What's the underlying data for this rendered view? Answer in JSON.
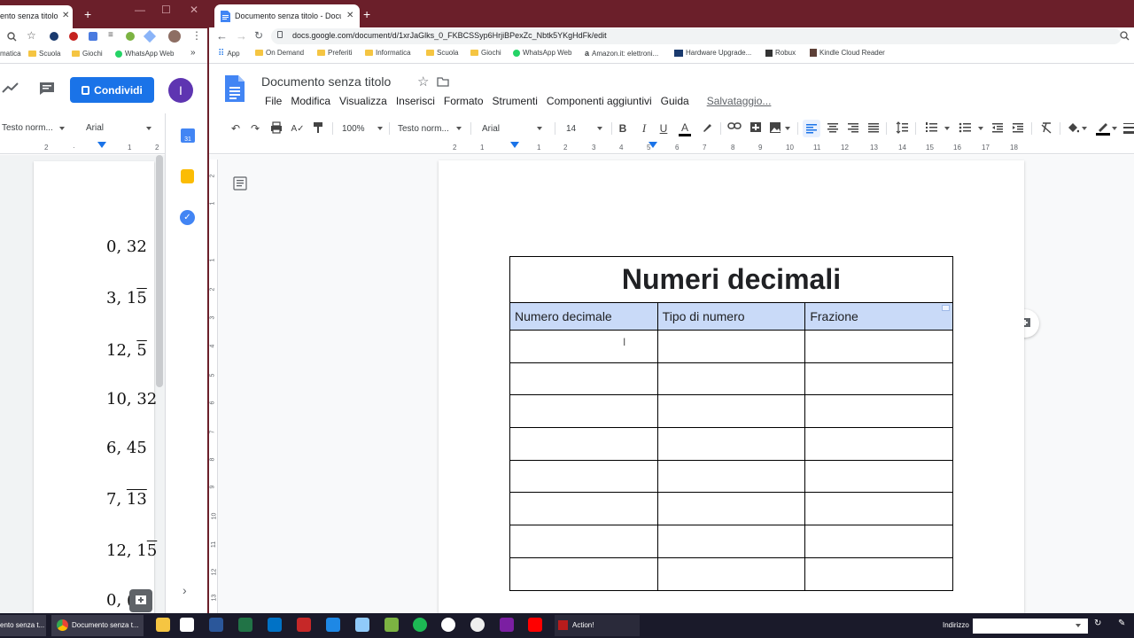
{
  "left_window": {
    "tab_title": "ento senza titolo - Do",
    "new_tab": "+",
    "win_minimize": "—",
    "win_maximize": "☐",
    "bookmarks": [
      "matica",
      "Scuola",
      "Giochi",
      "WhatsApp Web",
      "»"
    ],
    "share_button": "Condividi",
    "avatar_letter": "I",
    "style_dropdown": "Testo norm...",
    "font_dropdown": "Arial",
    "ruler_labels": [
      "2",
      "1",
      "1",
      "2"
    ],
    "math_lines": [
      {
        "whole": "0, 32",
        "period": ""
      },
      {
        "whole": "3, 1",
        "period": "5"
      },
      {
        "whole": "12, ",
        "period": "5"
      },
      {
        "whole": "10, 32",
        "period": ""
      },
      {
        "whole": "6, 45",
        "period": ""
      },
      {
        "whole": "7, ",
        "period": "13"
      },
      {
        "whole": "12, 1",
        "period": "5"
      },
      {
        "whole": "0, (",
        "period": ""
      }
    ],
    "calendar_badge": "31"
  },
  "browser": {
    "tab_title": "Documento senza titolo - Docum",
    "new_tab": "+",
    "url": "docs.google.com/document/d/1xrJaGlks_0_FKBCSSyp6HrjiBPexZc_Nbtk5YKgHdFk/edit",
    "bookmarks": [
      "App",
      "On Demand",
      "Preferiti",
      "Informatica",
      "Scuola",
      "Giochi",
      "WhatsApp Web",
      "Amazon.it: elettroni...",
      "Hardware Upgrade...",
      "Robux",
      "Kindle Cloud Reader"
    ]
  },
  "doc": {
    "title": "Documento senza titolo",
    "menu": [
      "File",
      "Modifica",
      "Visualizza",
      "Inserisci",
      "Formato",
      "Strumenti",
      "Componenti aggiuntivi",
      "Guida"
    ],
    "saving_status": "Salvataggio...",
    "toolbar": {
      "zoom": "100%",
      "style": "Testo norm...",
      "font": "Arial",
      "size": "14",
      "bold": "B",
      "italic": "I",
      "underline": "U",
      "text_color": "A"
    },
    "ruler_labels": [
      "2",
      "1",
      "1",
      "2",
      "3",
      "4",
      "5",
      "6",
      "7",
      "8",
      "9",
      "10",
      "11",
      "12",
      "13",
      "14",
      "15",
      "16",
      "17",
      "18"
    ],
    "vruler_labels": [
      "2",
      "1",
      "1",
      "2",
      "3",
      "4",
      "5",
      "6",
      "7",
      "8",
      "9",
      "10",
      "11",
      "12",
      "13"
    ],
    "table": {
      "title": "Numeri decimali",
      "headers": [
        "Numero decimale",
        "Tipo di numero",
        "Frazione"
      ],
      "empty_rows": 8
    },
    "colors": {
      "header_fill": "#c9daf8",
      "share_blue": "#1a73e8",
      "tabstrip": "#6b1f2a"
    }
  },
  "taskbar": {
    "items": [
      {
        "label": "ento senza t..."
      },
      {
        "label": "Documento senza t..."
      },
      {
        "label": "Action!"
      }
    ],
    "address_label": "Indirizzo"
  }
}
